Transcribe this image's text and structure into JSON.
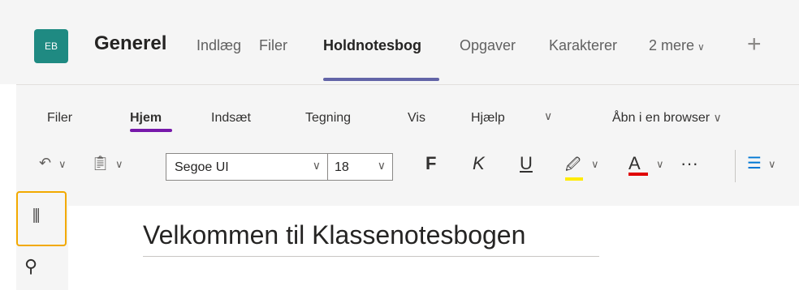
{
  "channel": {
    "avatar_initials": "EB",
    "name": "Generel",
    "tabs": [
      {
        "label": "Indlæg"
      },
      {
        "label": "Filer"
      },
      {
        "label": "Holdnotesbog"
      },
      {
        "label": "Opgaver"
      },
      {
        "label": "Karakterer"
      },
      {
        "label": "2 mere"
      }
    ],
    "add_tab_label": "+"
  },
  "ribbon": {
    "tabs": [
      "Filer",
      "Hjem",
      "Indsæt",
      "Tegning",
      "Vis",
      "Hjælp"
    ],
    "open_in_browser": "Åbn i en browser",
    "font_name": "Segoe UI",
    "font_size": "18",
    "bold": "F",
    "italic": "K",
    "underline": "U",
    "more": "···"
  },
  "page": {
    "title": "Velkommen til Klassenotesbogen"
  },
  "colors": {
    "accent_tab": "#6264a7",
    "ribbon_accent": "#7719aa",
    "avatar": "#1f8a82",
    "highlight": "#ffeb00",
    "font_color": "#e00000",
    "notebook_border": "#f2a900",
    "arrow": "#f07e2a"
  }
}
